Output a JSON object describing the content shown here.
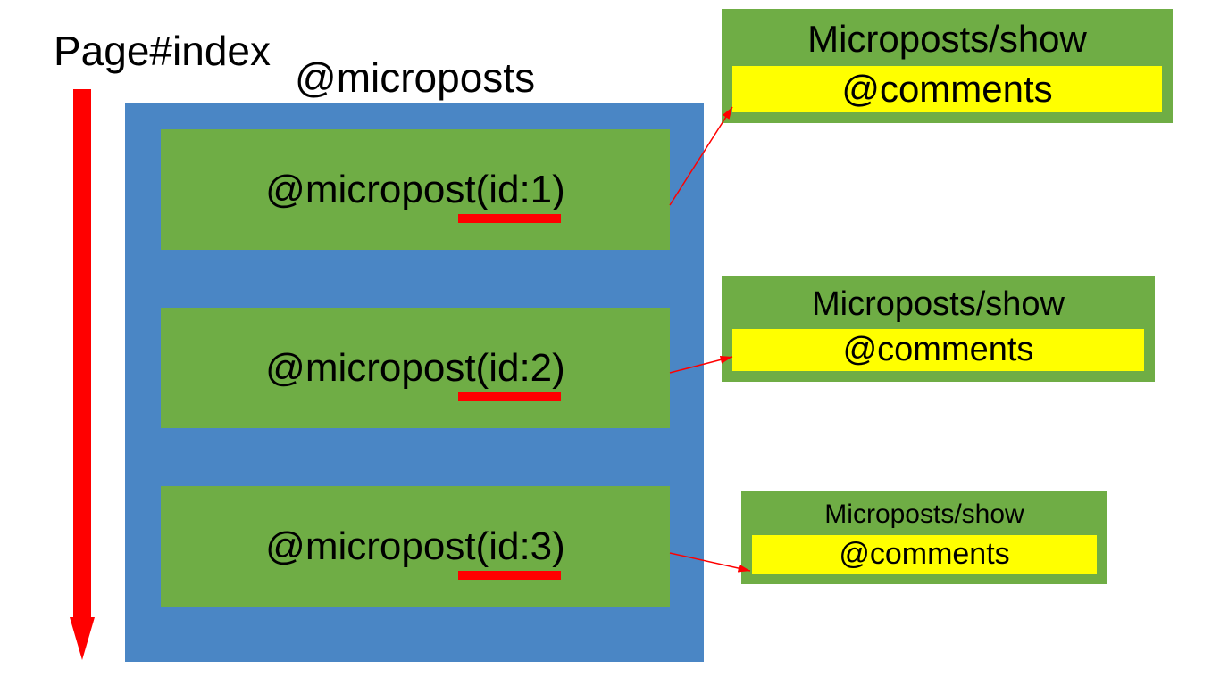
{
  "page_title": "Page#index",
  "collection_label": "@microposts",
  "items": [
    {
      "label": "@micropost(id:1)"
    },
    {
      "label": "@micropost(id:2)"
    },
    {
      "label": "@micropost(id:3)"
    }
  ],
  "show_boxes": [
    {
      "title": "Microposts/show",
      "comments": "@comments"
    },
    {
      "title": "Microposts/show",
      "comments": "@comments"
    },
    {
      "title": "Microposts/show",
      "comments": "@comments"
    }
  ],
  "colors": {
    "container": "#4a86c5",
    "node": "#6fad45",
    "highlight": "#ffff00",
    "arrow": "#ff0000"
  }
}
